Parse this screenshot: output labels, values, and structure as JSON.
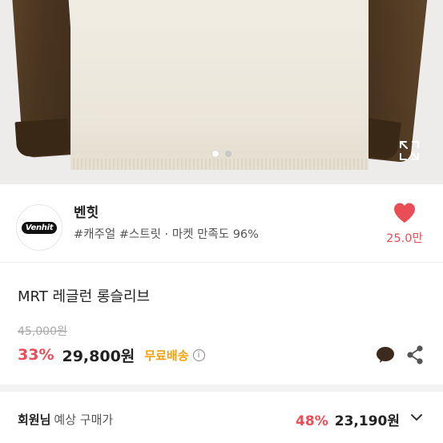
{
  "carousel": {
    "total": 2,
    "active": 1
  },
  "seller": {
    "logo_text": "Venhit",
    "name": "벤힛",
    "tags": "#캐주얼 #스트릿 · 마켓 만족도 96%",
    "like_count": "25.0만"
  },
  "product": {
    "title": "MRT 레글런 롱슬리브",
    "original_price": "45,000원",
    "discount": "33%",
    "sale_price": "29,800원",
    "free_shipping": "무료배송",
    "info_icon": "i"
  },
  "member": {
    "label_strong": "회원님",
    "label_sub": "예상 구매가",
    "discount": "48%",
    "price": "23,190원"
  },
  "icons": {
    "heart": "heart-icon",
    "kakaotalk": "kakaotalk-icon",
    "share": "share-icon",
    "expand": "expand-icon",
    "chevron": "chevron-down-icon"
  },
  "colors": {
    "accent_red": "#e94d55",
    "free_shipping": "#f0a20e",
    "kakao": "#3c2a1e"
  }
}
